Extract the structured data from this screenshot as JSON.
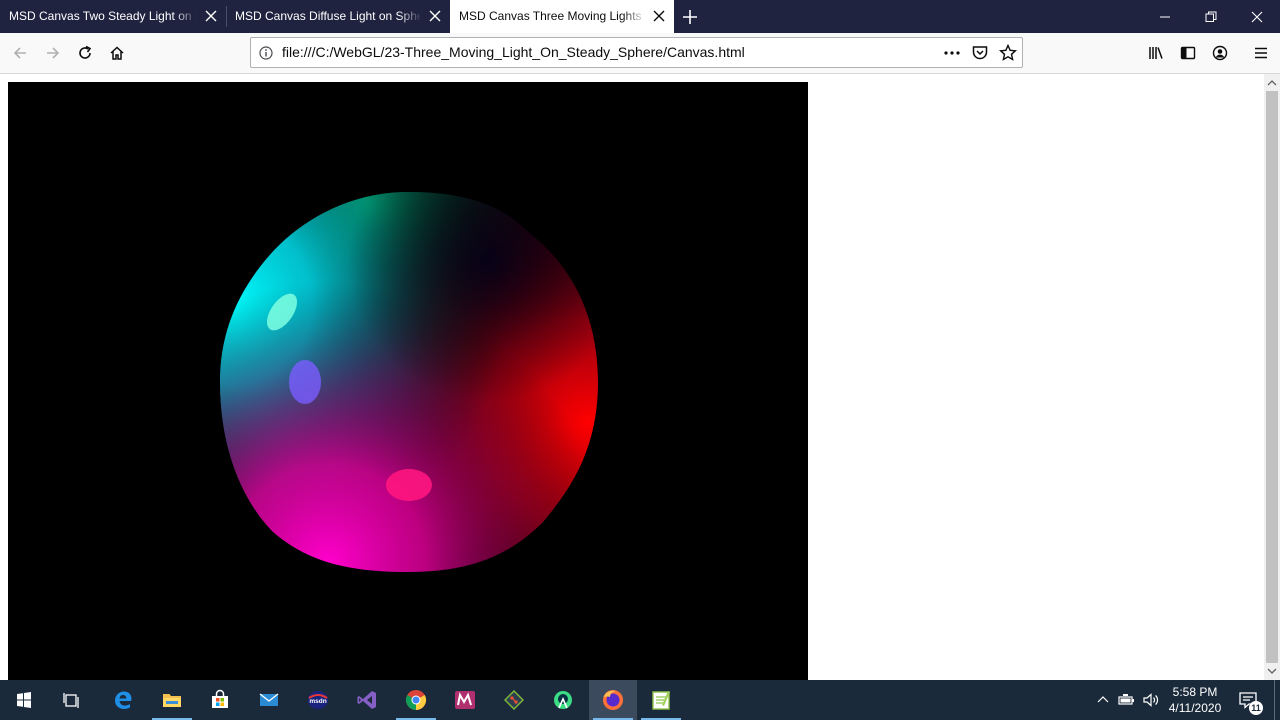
{
  "browser": {
    "tabs": [
      {
        "title": "MSD Canvas Two Steady Light on Rotating Sphere",
        "active": false
      },
      {
        "title": "MSD Canvas Diffuse Light on Sphere",
        "active": false
      },
      {
        "title": "MSD Canvas Three Moving Lights On Steady Sphere",
        "active": true
      }
    ],
    "url": "file:///C:/WebGL/23-Three_Moving_Light_On_Steady_Sphere/Canvas.html",
    "accent_color": "#202340"
  },
  "taskbar": {
    "apps": [
      {
        "icon": "windows-start-icon"
      },
      {
        "icon": "task-view-icon"
      },
      {
        "icon": "edge-icon"
      },
      {
        "icon": "file-explorer-icon",
        "running": true
      },
      {
        "icon": "store-icon"
      },
      {
        "icon": "mail-icon"
      },
      {
        "icon": "msdn-icon",
        "label": "msdn"
      },
      {
        "icon": "visual-studio-icon"
      },
      {
        "icon": "chrome-icon",
        "running": true
      },
      {
        "icon": "mathematica-icon"
      },
      {
        "icon": "git-icon"
      },
      {
        "icon": "android-studio-icon"
      },
      {
        "icon": "firefox-icon",
        "running": true,
        "active": true
      },
      {
        "icon": "notepad-plus-icon",
        "running": true
      }
    ],
    "clock": {
      "time": "5:58 PM",
      "date": "4/11/2020"
    },
    "notifications": {
      "count": "11"
    }
  }
}
